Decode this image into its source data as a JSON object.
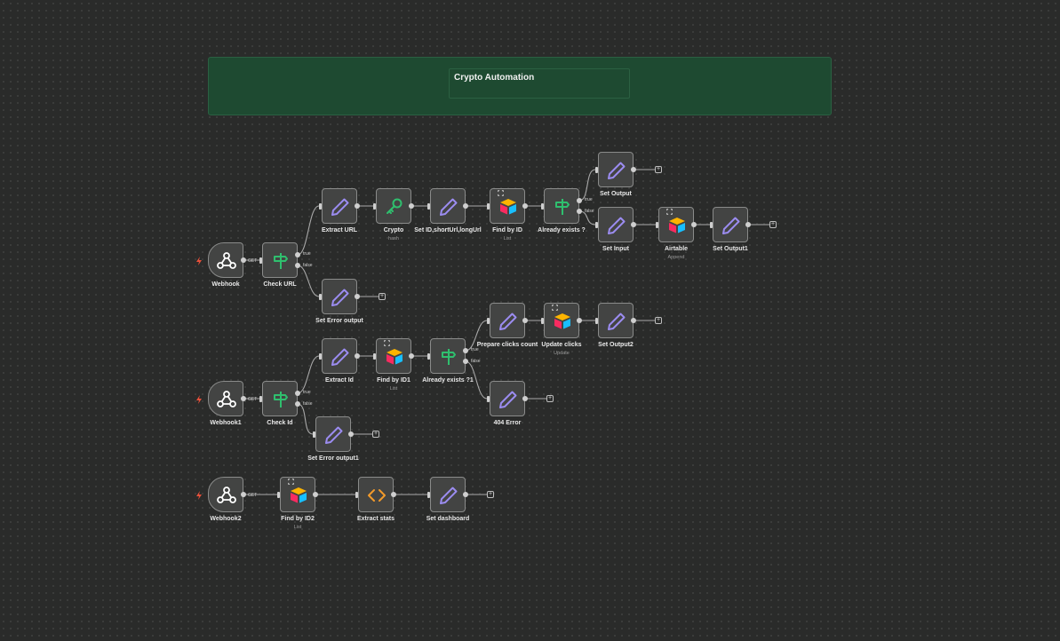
{
  "sticky": {
    "title": "Crypto Automation"
  },
  "nodes": {
    "webhook": {
      "label": "Webhook",
      "icon": "webhook-icon"
    },
    "check_url": {
      "label": "Check URL",
      "icon": "if-icon"
    },
    "extract_url": {
      "label": "Extract URL",
      "icon": "pencil-icon"
    },
    "crypto": {
      "label": "Crypto",
      "sub": "hash",
      "icon": "key-icon"
    },
    "set_id": {
      "label": "Set ID,shortUrl,longUrl",
      "icon": "pencil-icon"
    },
    "find_by_id": {
      "label": "Find by ID",
      "sub": "List",
      "icon": "airtable-icon"
    },
    "already_exists": {
      "label": "Already exists ?",
      "icon": "if-icon"
    },
    "set_output": {
      "label": "Set Output",
      "icon": "pencil-icon"
    },
    "set_input": {
      "label": "Set Input",
      "icon": "pencil-icon"
    },
    "airtable": {
      "label": "Airtable",
      "sub": "Append",
      "icon": "airtable-icon"
    },
    "set_output1": {
      "label": "Set Output1",
      "icon": "pencil-icon"
    },
    "set_error": {
      "label": "Set Error output",
      "icon": "pencil-icon"
    },
    "webhook1": {
      "label": "Webhook1",
      "icon": "webhook-icon"
    },
    "check_id": {
      "label": "Check Id",
      "icon": "if-icon"
    },
    "extract_id": {
      "label": "Extract Id",
      "icon": "pencil-icon"
    },
    "find_by_id1": {
      "label": "Find by ID1",
      "sub": "List",
      "icon": "airtable-icon"
    },
    "already_exists1": {
      "label": "Already exists ?1",
      "icon": "if-icon"
    },
    "prepare_clicks": {
      "label": "Prepare clicks count",
      "icon": "pencil-icon"
    },
    "update_clicks": {
      "label": "Update clicks",
      "sub": "Update",
      "icon": "airtable-icon"
    },
    "set_output2": {
      "label": "Set Output2",
      "icon": "pencil-icon"
    },
    "error_404": {
      "label": "404 Error",
      "icon": "pencil-icon"
    },
    "set_error1": {
      "label": "Set Error output1",
      "icon": "pencil-icon"
    },
    "webhook2": {
      "label": "Webhook2",
      "icon": "webhook-icon"
    },
    "find_by_id2": {
      "label": "Find by ID2",
      "sub": "List",
      "icon": "airtable-icon"
    },
    "extract_stats": {
      "label": "Extract stats",
      "icon": "code-icon"
    },
    "set_dashboard": {
      "label": "Set dashboard",
      "icon": "pencil-icon"
    }
  },
  "edge_labels": {
    "get": "GET",
    "true": "true",
    "false": "false"
  },
  "colors": {
    "background": "#2a2b2a",
    "sticky": "#1e4a31",
    "node": "#434443",
    "pencil": "#9b8cf0",
    "if": "#2fbf6e",
    "trigger_bolt": "#e8503a",
    "code": "#f29a2b"
  }
}
